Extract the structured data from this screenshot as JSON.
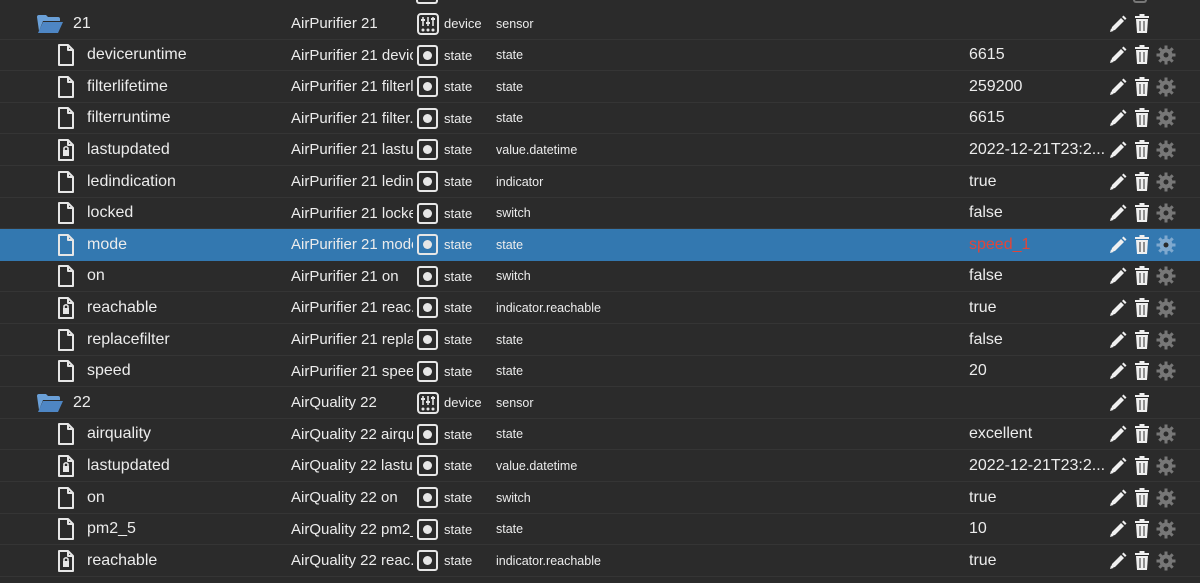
{
  "colors": {
    "background": "#2b2b2b",
    "selected": "#3378b0",
    "error_value": "#e0463a",
    "icon": "#e6e6e6",
    "gear_disabled": "#777777"
  },
  "rows": [
    {
      "kind": "folder",
      "name": "21",
      "fullname": "AirPurifier 21",
      "type": "device",
      "role": "sensor",
      "value": "",
      "role_icon": "device-icon",
      "selected": false
    },
    {
      "kind": "file",
      "name": "deviceruntime",
      "fullname": "AirPurifier 21 devic...",
      "type": "state",
      "role": "state",
      "value": "6615",
      "role_icon": "state-icon",
      "selected": false
    },
    {
      "kind": "file",
      "name": "filterlifetime",
      "fullname": "AirPurifier 21 filterl...",
      "type": "state",
      "role": "state",
      "value": "259200",
      "role_icon": "state-icon",
      "selected": false
    },
    {
      "kind": "file",
      "name": "filterruntime",
      "fullname": "AirPurifier 21 filter...",
      "type": "state",
      "role": "state",
      "value": "6615",
      "role_icon": "state-icon",
      "selected": false
    },
    {
      "kind": "locked-file",
      "name": "lastupdated",
      "fullname": "AirPurifier 21 lastu...",
      "type": "state",
      "role": "value.datetime",
      "value": "2022-12-21T23:2...",
      "role_icon": "state-icon",
      "selected": false
    },
    {
      "kind": "file",
      "name": "ledindication",
      "fullname": "AirPurifier 21 ledin...",
      "type": "state",
      "role": "indicator",
      "value": "true",
      "role_icon": "state-icon",
      "selected": false
    },
    {
      "kind": "file",
      "name": "locked",
      "fullname": "AirPurifier 21 locked",
      "type": "state",
      "role": "switch",
      "value": "false",
      "role_icon": "state-icon",
      "selected": false
    },
    {
      "kind": "file",
      "name": "mode",
      "fullname": "AirPurifier 21 mode",
      "type": "state",
      "role": "state",
      "value": "speed_1",
      "role_icon": "state-icon",
      "selected": true,
      "value_color": "red"
    },
    {
      "kind": "file",
      "name": "on",
      "fullname": "AirPurifier 21 on",
      "type": "state",
      "role": "switch",
      "value": "false",
      "role_icon": "state-icon",
      "selected": false
    },
    {
      "kind": "locked-file",
      "name": "reachable",
      "fullname": "AirPurifier 21 reac...",
      "type": "state",
      "role": "indicator.reachable",
      "value": "true",
      "role_icon": "state-icon",
      "selected": false
    },
    {
      "kind": "file",
      "name": "replacefilter",
      "fullname": "AirPurifier 21 repla...",
      "type": "state",
      "role": "state",
      "value": "false",
      "role_icon": "state-icon",
      "selected": false
    },
    {
      "kind": "file",
      "name": "speed",
      "fullname": "AirPurifier 21 speed",
      "type": "state",
      "role": "state",
      "value": "20",
      "role_icon": "state-icon",
      "selected": false
    },
    {
      "kind": "folder",
      "name": "22",
      "fullname": "AirQuality 22",
      "type": "device",
      "role": "sensor",
      "value": "",
      "role_icon": "device-icon",
      "selected": false
    },
    {
      "kind": "file",
      "name": "airquality",
      "fullname": "AirQuality 22 airqu...",
      "type": "state",
      "role": "state",
      "value": "excellent",
      "role_icon": "state-icon",
      "selected": false
    },
    {
      "kind": "locked-file",
      "name": "lastupdated",
      "fullname": "AirQuality 22 lastu...",
      "type": "state",
      "role": "value.datetime",
      "value": "2022-12-21T23:2...",
      "role_icon": "state-icon",
      "selected": false
    },
    {
      "kind": "file",
      "name": "on",
      "fullname": "AirQuality 22 on",
      "type": "state",
      "role": "switch",
      "value": "true",
      "role_icon": "state-icon",
      "selected": false
    },
    {
      "kind": "file",
      "name": "pm2_5",
      "fullname": "AirQuality 22 pm2_5",
      "type": "state",
      "role": "state",
      "value": "10",
      "role_icon": "state-icon",
      "selected": false
    },
    {
      "kind": "locked-file",
      "name": "reachable",
      "fullname": "AirQuality 22 reac...",
      "type": "state",
      "role": "indicator.reachable",
      "value": "true",
      "role_icon": "state-icon",
      "selected": false
    }
  ]
}
